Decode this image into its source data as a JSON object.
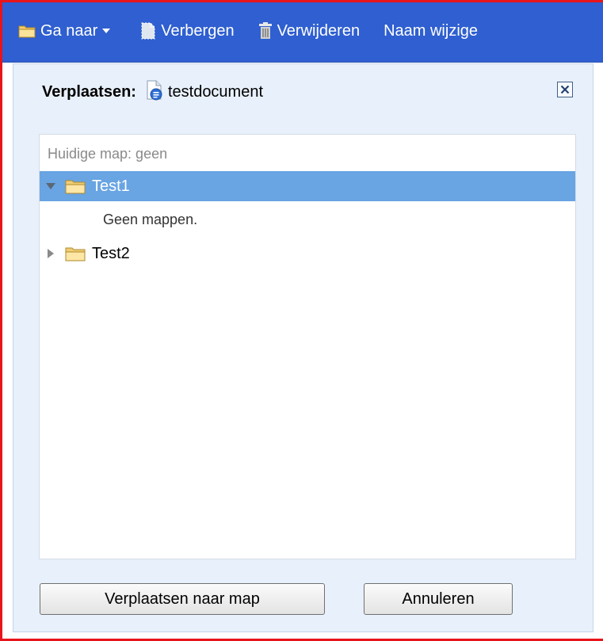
{
  "toolbar": {
    "goto_label": "Ga naar",
    "hide_label": "Verbergen",
    "delete_label": "Verwijderen",
    "rename_label": "Naam wijzige"
  },
  "dialog": {
    "title": "Verplaatsen:",
    "document_name": "testdocument",
    "close_icon": "close-icon",
    "tree": {
      "current_folder": "Huidige map: geen",
      "folders": [
        {
          "label": "Test1",
          "expanded": true,
          "selected": true,
          "empty_text": "Geen mappen."
        },
        {
          "label": "Test2",
          "expanded": false,
          "selected": false
        }
      ]
    },
    "buttons": {
      "move_label": "Verplaatsen naar map",
      "cancel_label": "Annuleren"
    }
  },
  "colors": {
    "toolbar_bg": "#2f5fd0",
    "panel_bg": "#e8f0fb",
    "selected_row": "#69a4e3",
    "frame_border": "#e8141b"
  }
}
